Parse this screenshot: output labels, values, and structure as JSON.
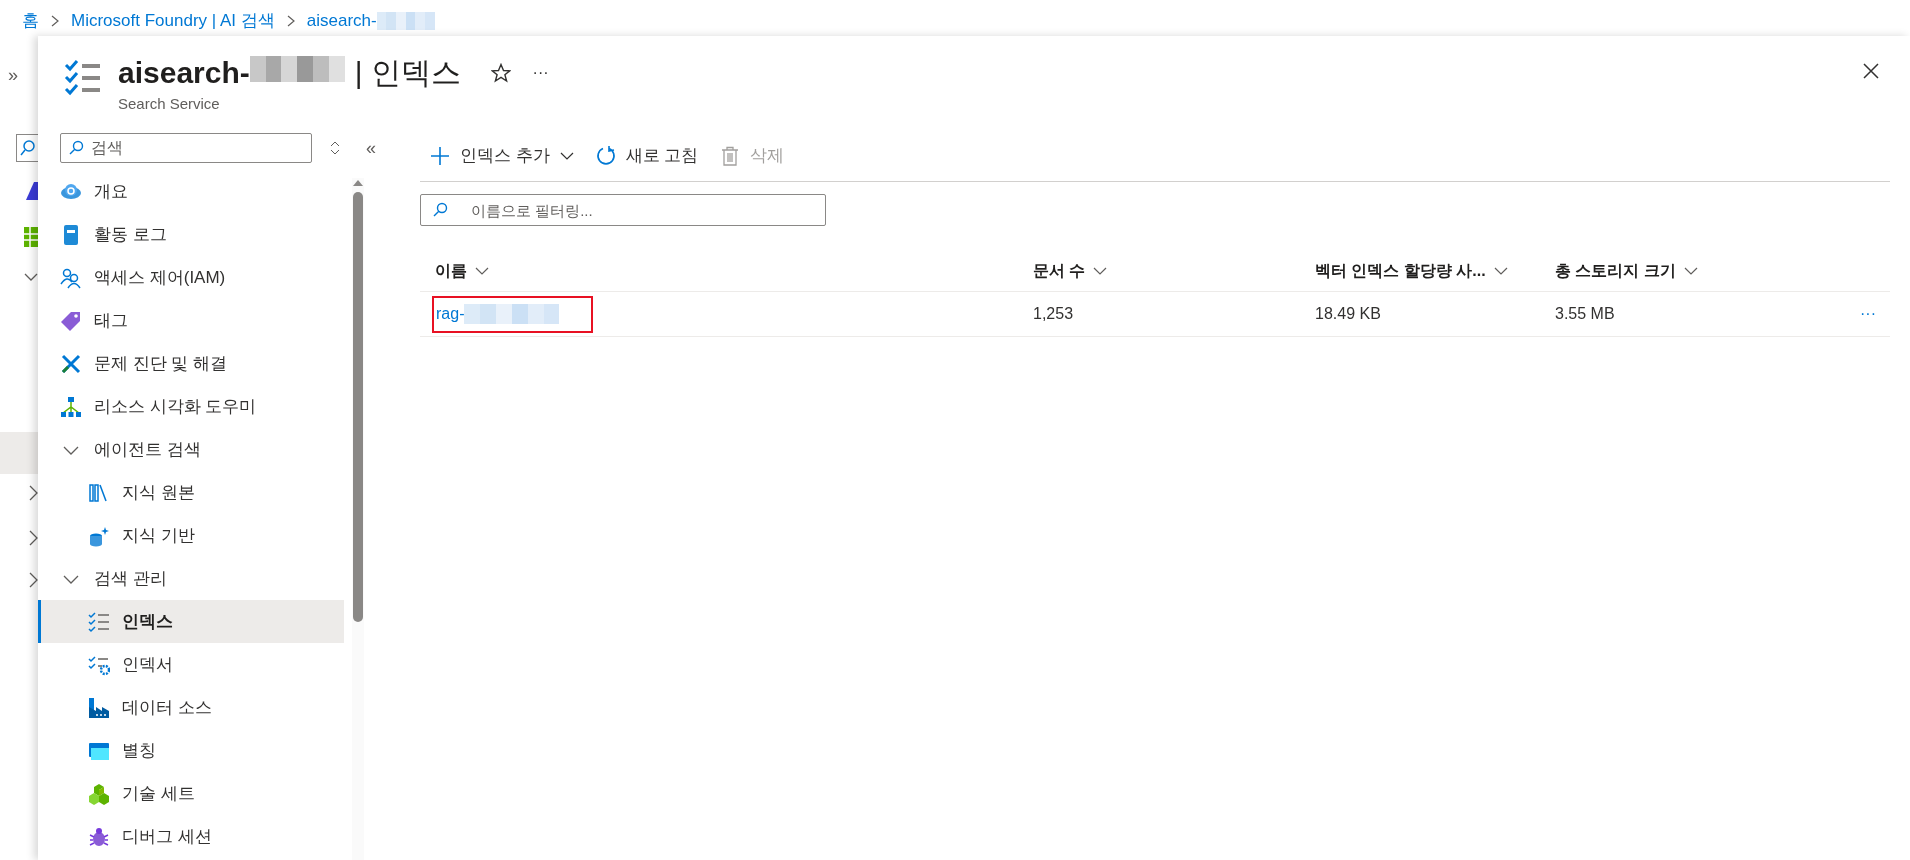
{
  "breadcrumb": [
    {
      "label": "홈"
    },
    {
      "label": "Microsoft Foundry | AI 검색"
    },
    {
      "label": "aisearch-",
      "redacted": true
    }
  ],
  "side_rail": {
    "expand": "»"
  },
  "header": {
    "name": "aisearch-",
    "name_redacted": true,
    "separator": "|",
    "page": "인덱스",
    "subtitle": "Search Service",
    "favorite": false,
    "more": "···"
  },
  "sidebar": {
    "search": {
      "placeholder": "검색"
    },
    "collapse": "«",
    "items": [
      {
        "label": "개요",
        "kind": "overview",
        "selected": false
      },
      {
        "label": "활동 로그",
        "kind": "log",
        "selected": false
      },
      {
        "label": "액세스 제어(IAM)",
        "kind": "iam",
        "selected": false
      },
      {
        "label": "태그",
        "kind": "tag",
        "selected": false
      },
      {
        "label": "문제 진단 및 해결",
        "kind": "tools",
        "selected": false
      },
      {
        "label": "리소스 시각화 도우미",
        "kind": "visual",
        "selected": false
      },
      {
        "label": "에이전트 검색",
        "kind": "group",
        "expanded": true,
        "selected": false,
        "children": [
          {
            "label": "지식 원본",
            "kind": "books",
            "selected": false
          },
          {
            "label": "지식 기반",
            "kind": "db",
            "selected": false
          }
        ]
      },
      {
        "label": "검색 관리",
        "kind": "group",
        "expanded": true,
        "selected": false,
        "children": [
          {
            "label": "인덱스",
            "kind": "index",
            "selected": true
          },
          {
            "label": "인덱서",
            "kind": "indexer",
            "selected": false
          },
          {
            "label": "데이터 소스",
            "kind": "factory",
            "selected": false
          },
          {
            "label": "별칭",
            "kind": "alias",
            "selected": false
          },
          {
            "label": "기술 세트",
            "kind": "cubes",
            "selected": false
          },
          {
            "label": "디버그 세션",
            "kind": "bug",
            "selected": false
          }
        ]
      }
    ]
  },
  "toolbar": [
    {
      "label": "인덱스 추가",
      "kind": "plus",
      "dropdown": true,
      "disabled": false
    },
    {
      "label": "새로 고침",
      "kind": "refresh",
      "dropdown": false,
      "disabled": false
    },
    {
      "label": "삭제",
      "kind": "trash",
      "dropdown": false,
      "disabled": true
    }
  ],
  "filter": {
    "placeholder": "이름으로 필터링..."
  },
  "table": {
    "columns": [
      "이름",
      "문서 수",
      "벡터 인덱스 할당량 사...",
      "총 스토리지 크기"
    ],
    "rows": [
      {
        "cells": [
          "rag-",
          "1,253",
          "18.49 KB",
          "3.55 MB"
        ],
        "name_redacted": true,
        "highlighted": true,
        "more": "···"
      }
    ]
  }
}
